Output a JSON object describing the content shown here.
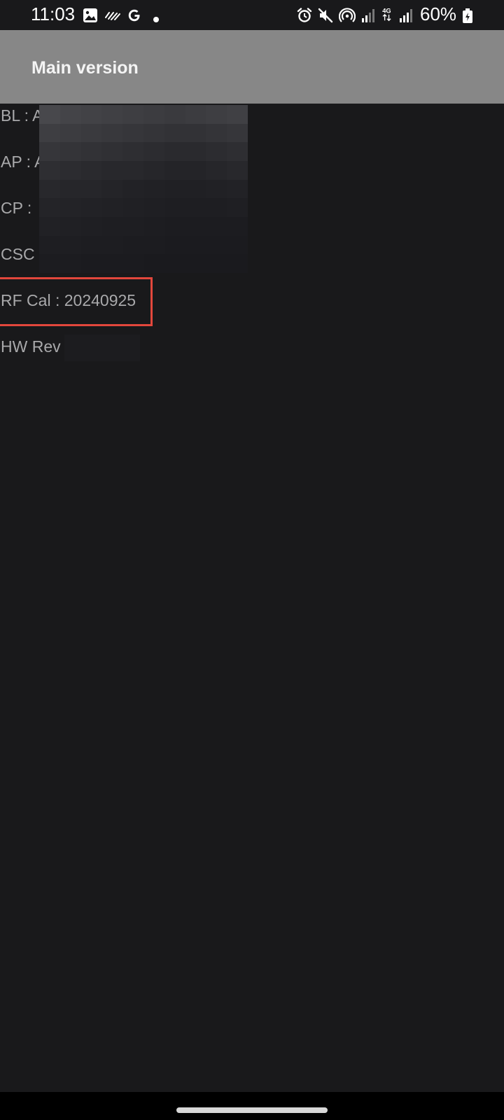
{
  "status_bar": {
    "time": "11:03",
    "battery": "60%",
    "left_icons": [
      "gallery-icon",
      "activity-icon",
      "google-icon",
      "dot-icon"
    ],
    "right_icons": [
      "alarm-icon",
      "mute-icon",
      "hotspot-icon",
      "signal-icon",
      "network-4g-icon",
      "signal-icon",
      "battery-icon"
    ]
  },
  "app_bar": {
    "title": "Main version"
  },
  "info": {
    "bl": "BL : A",
    "ap": "AP : A",
    "cp": "CP :",
    "csc": "CSC",
    "rf_cal": "RF Cal : 20240925",
    "hw_rev": "HW Rev"
  },
  "colors": {
    "background": "#19191b",
    "app_bar": "#878787",
    "highlight": "#e2473c",
    "text": "#a9a9ab"
  }
}
